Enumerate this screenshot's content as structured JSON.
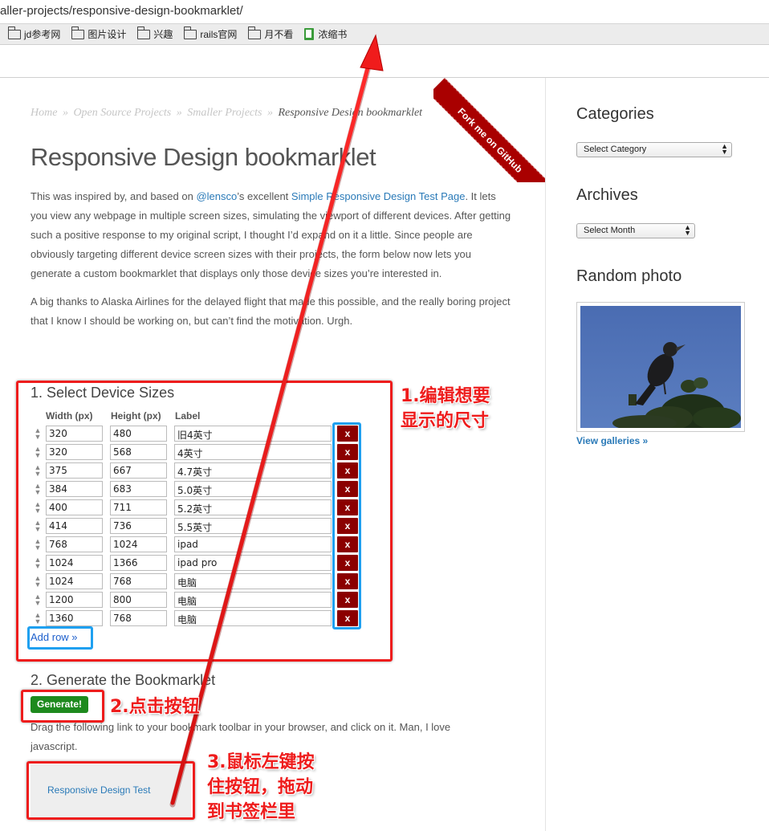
{
  "browser": {
    "url": "aller-projects/responsive-design-bookmarklet/",
    "bookmarks": [
      {
        "label": "jd参考网",
        "icon": "folder-icon"
      },
      {
        "label": "图片设计",
        "icon": "folder-icon"
      },
      {
        "label": "兴趣",
        "icon": "folder-icon"
      },
      {
        "label": "rails官网",
        "icon": "folder-icon"
      },
      {
        "label": "月不看",
        "icon": "folder-icon"
      },
      {
        "label": "浓缩书",
        "icon": "book-icon"
      }
    ]
  },
  "breadcrumb": {
    "home": "Home",
    "sep": "»",
    "open_source": "Open Source Projects",
    "smaller": "Smaller Projects",
    "current": "Responsive Design bookmarklet"
  },
  "ribbon": "Fork me on GitHub",
  "page": {
    "title": "Responsive Design bookmarklet",
    "para1_a": "This was inspired by, and based on ",
    "para1_link1": "@lensco",
    "para1_b": "’s excellent ",
    "para1_link2": "Simple Responsive Design Test Page",
    "para1_c": ". It lets you view any webpage in multiple screen sizes, simulating the viewport of different devices. After getting such a positive response to my original script, I thought I’d expand on it a little. Since people are obviously targeting different device screen sizes with their projects, the form below now lets you generate a custom bookmarklet that displays only those device sizes you’re interested in.",
    "para2": "A big thanks to Alaska Airlines for the delayed flight that made this possible, and the really boring project that I know I should be working on, but can’t find the motivation. Urgh."
  },
  "devices": {
    "heading": "1. Select Device Sizes",
    "col_width": "Width (px)",
    "col_height": "Height (px)",
    "col_label": "Label",
    "delete_label": "x",
    "add_row": "Add row »",
    "rows": [
      {
        "w": "320",
        "h": "480",
        "label": "旧4英寸"
      },
      {
        "w": "320",
        "h": "568",
        "label": "4英寸"
      },
      {
        "w": "375",
        "h": "667",
        "label": "4.7英寸"
      },
      {
        "w": "384",
        "h": "683",
        "label": "5.0英寸"
      },
      {
        "w": "400",
        "h": "711",
        "label": "5.2英寸"
      },
      {
        "w": "414",
        "h": "736",
        "label": "5.5英寸"
      },
      {
        "w": "768",
        "h": "1024",
        "label": "ipad"
      },
      {
        "w": "1024",
        "h": "1366",
        "label": "ipad pro"
      },
      {
        "w": "1024",
        "h": "768",
        "label": "电脑"
      },
      {
        "w": "1200",
        "h": "800",
        "label": "电脑"
      },
      {
        "w": "1360",
        "h": "768",
        "label": "电脑"
      }
    ]
  },
  "generate": {
    "heading": "2. Generate the Bookmarklet",
    "button": "Generate!",
    "instructions": "Drag the following link to your bookmark toolbar in your browser, and click on it. Man, I love javascript.",
    "bookmarklet_link": "Responsive Design Test"
  },
  "sidebar": {
    "categories_title": "Categories",
    "categories_select": "Select Category",
    "archives_title": "Archives",
    "archives_select": "Select Month",
    "photo_title": "Random photo",
    "gallery_link": "View galleries »"
  },
  "annotations": {
    "step1_line1": "1.编辑想要",
    "step1_line2": "显示的尺寸",
    "step2": "2.点击按钮",
    "step3_line1": "3.鼠标左键按",
    "step3_line2": "住按钮，拖动",
    "step3_line3": "到书签栏里"
  },
  "colors": {
    "annotation_red": "#ee1c1c",
    "annotation_blue": "#1fa0f0",
    "ribbon": "#a90000",
    "delete_button": "#8b0000",
    "generate_button": "#1e8a1e",
    "link": "#2a7ab8"
  }
}
